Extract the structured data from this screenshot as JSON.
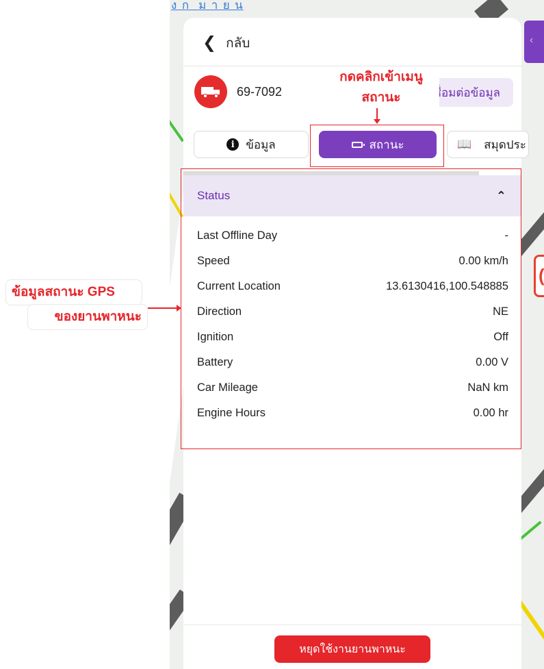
{
  "map": {
    "top_label": "ง ก ่ ม า ย น"
  },
  "panel": {
    "back_label": "กลับ",
    "vehicle": {
      "plate": "69-7092",
      "connect_label": "เชื่อมต่อข้อมูล"
    },
    "tabs": [
      {
        "label": "ข้อมูล",
        "icon": "info-circle-icon",
        "active": false
      },
      {
        "label": "สถานะ",
        "icon": "battery-icon",
        "active": true
      },
      {
        "label": "สมุดประ",
        "icon": "book-icon",
        "active": false
      }
    ],
    "status_section": {
      "title": "Status",
      "expanded": true,
      "rows": [
        {
          "label": "Last Offline Day",
          "value": "-"
        },
        {
          "label": "Speed",
          "value": "0.00 km/h"
        },
        {
          "label": "Current Location",
          "value": "13.6130416,100.548885"
        },
        {
          "label": "Direction",
          "value": "NE"
        },
        {
          "label": "Ignition",
          "value": "Off"
        },
        {
          "label": "Battery",
          "value": "0.00 V"
        },
        {
          "label": "Car Mileage",
          "value": "NaN km"
        },
        {
          "label": "Engine Hours",
          "value": "0.00 hr"
        }
      ]
    },
    "stop_button_label": "หยุดใช้งานยานพาหนะ"
  },
  "annotations": {
    "top_callout_line1": "กดคลิกเข้าเมนู",
    "top_callout_line2": "สถานะ",
    "left_callout_line1": "ข้อมูลสถานะ GPS",
    "left_callout_line2": "ของยานพาหนะ"
  },
  "colors": {
    "accent_purple": "#7b3fbe",
    "status_header_bg": "#ebe5f4",
    "alert_red": "#e5262b"
  }
}
